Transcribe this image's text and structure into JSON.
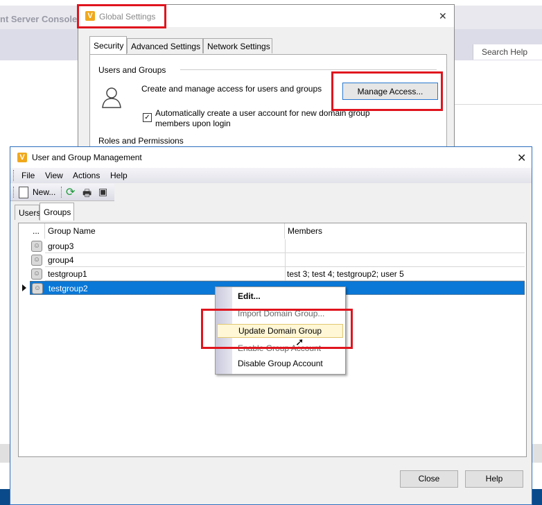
{
  "background_console": {
    "title": "nt Server Console 2",
    "search_placeholder": "Search Help"
  },
  "global_settings": {
    "title": "Global Settings",
    "logo": "V",
    "tabs": [
      {
        "label": "Security",
        "active": true
      },
      {
        "label": "Advanced Settings",
        "active": false
      },
      {
        "label": "Network Settings",
        "active": false
      }
    ],
    "users_groups_heading": "Users and Groups",
    "create_text": "Create and manage access for users and groups",
    "manage_access_label": "Manage Access...",
    "auto_create_checked": true,
    "auto_create_text": "Automatically create a user account for new domain group members upon login",
    "roles_heading": "Roles and Permissions"
  },
  "user_group_window": {
    "title": "User and Group Management",
    "logo": "V",
    "menu": [
      "File",
      "View",
      "Actions",
      "Help"
    ],
    "toolbar": {
      "new_label": "New..."
    },
    "tabs": [
      {
        "label": "Users",
        "active": false
      },
      {
        "label": "Groups",
        "active": true
      }
    ],
    "columns": {
      "dots": "...",
      "name": "Group Name",
      "members": "Members"
    },
    "rows": [
      {
        "name": "group3",
        "members": ""
      },
      {
        "name": "group4",
        "members": ""
      },
      {
        "name": "testgroup1",
        "members": "test 3; test 4; testgroup2; user 5"
      },
      {
        "name": "testgroup2",
        "members": "",
        "selected": true
      }
    ],
    "close_label": "Close",
    "help_label": "Help"
  },
  "context_menu": {
    "items": [
      {
        "label": "Edit..."
      },
      {
        "label": "Import Domain Group..."
      },
      {
        "label": "Update Domain Group",
        "highlighted": true
      },
      {
        "label": "Enable Group Account"
      },
      {
        "label": "Disable Group Account"
      }
    ]
  },
  "colors": {
    "highlight_box": "#e0141e",
    "selection": "#0a78d7",
    "logo": "#f0a81c"
  }
}
